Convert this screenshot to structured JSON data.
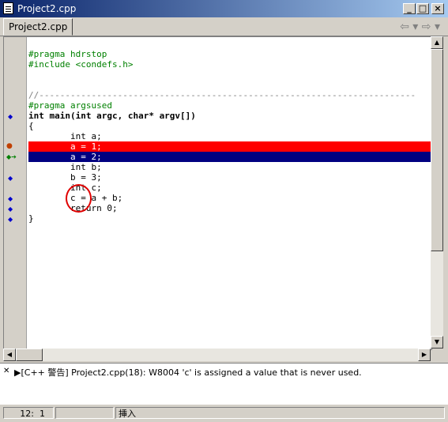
{
  "window": {
    "title": "Project2.cpp",
    "min_label": "_",
    "max_label": "□",
    "close_label": "×"
  },
  "tabs": [
    {
      "label": "Project2.cpp"
    }
  ],
  "nav": {
    "back": "⇦ ▾",
    "forward": "⇨ ▾"
  },
  "code_lines": [
    "#pragma hdrstop",
    "#include <condefs.h>",
    "",
    "",
    "//------------------------------------------------------------------------",
    "#pragma argsused",
    "int main(int argc, char* argv[])",
    "{",
    "        int a;",
    "        a = 1;",
    "        a = 2;",
    "        int b;",
    "        b = 3;",
    "        int c;",
    "        c = a + b;",
    "        return 0;",
    "}"
  ],
  "message": "[C++ 警告] Project2.cpp(18): W8004 'c' is assigned a value that is never used.",
  "status": {
    "line": "12",
    "col": "1",
    "mode": "挿入"
  },
  "colors": {
    "breakpoint": "#ff0000",
    "execution": "#000080",
    "directive": "#008000"
  }
}
